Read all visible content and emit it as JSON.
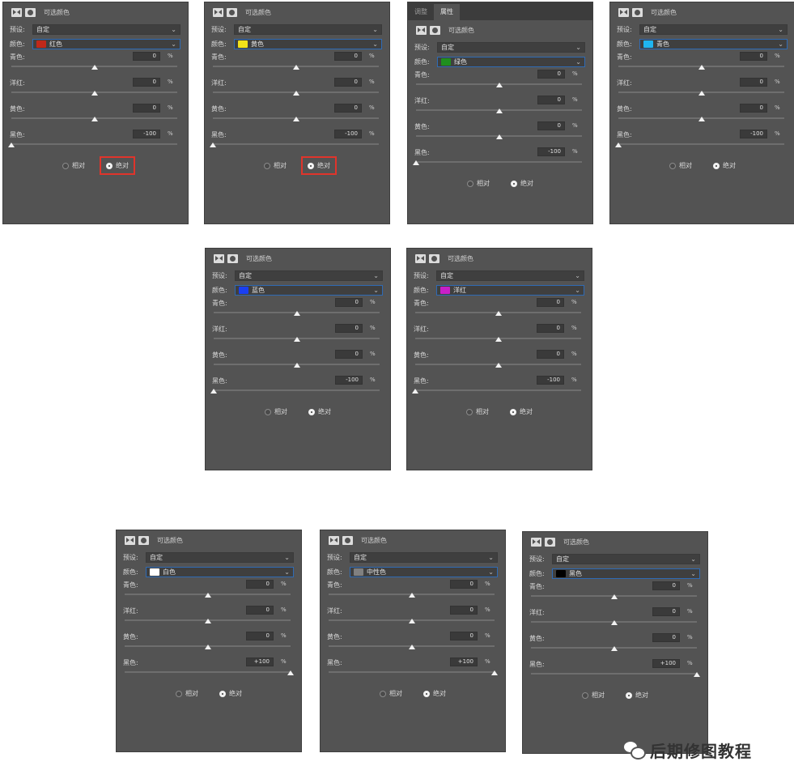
{
  "panel_labels": {
    "title": "可选颜色",
    "preset_label": "预设:",
    "preset_value": "自定",
    "color_label": "颜色:",
    "cyan": "青色:",
    "magenta": "洋红:",
    "yellow": "黄色:",
    "black": "黑色:",
    "relative": "相对",
    "absolute": "绝对",
    "percent": "%",
    "tab_adjust": "调整",
    "tab_properties": "属性"
  },
  "panels": [
    {
      "color_name": "红色",
      "swatch": "#c0281a",
      "values": [
        "0",
        "0",
        "0",
        "-100"
      ],
      "thumbs": [
        50,
        50,
        50,
        0
      ],
      "highlight": true,
      "tabs": false
    },
    {
      "color_name": "黄色",
      "swatch": "#f2e21a",
      "values": [
        "0",
        "0",
        "0",
        "-100"
      ],
      "thumbs": [
        50,
        50,
        50,
        0
      ],
      "highlight": true,
      "tabs": false
    },
    {
      "color_name": "绿色",
      "swatch": "#1f8f1f",
      "values": [
        "0",
        "0",
        "0",
        "-100"
      ],
      "thumbs": [
        50,
        50,
        50,
        0
      ],
      "highlight": false,
      "tabs": true
    },
    {
      "color_name": "青色",
      "swatch": "#1fb5f0",
      "values": [
        "0",
        "0",
        "0",
        "-100"
      ],
      "thumbs": [
        50,
        50,
        50,
        0
      ],
      "highlight": false,
      "tabs": false
    },
    {
      "color_name": "蓝色",
      "swatch": "#1a3ff2",
      "values": [
        "0",
        "0",
        "0",
        "-100"
      ],
      "thumbs": [
        50,
        50,
        50,
        0
      ],
      "highlight": false,
      "tabs": false
    },
    {
      "color_name": "洋红",
      "swatch": "#c81fc8",
      "values": [
        "0",
        "0",
        "0",
        "-100"
      ],
      "thumbs": [
        50,
        50,
        50,
        0
      ],
      "highlight": false,
      "tabs": false
    },
    {
      "color_name": "白色",
      "swatch": "#ffffff",
      "values": [
        "0",
        "0",
        "0",
        "+100"
      ],
      "thumbs": [
        50,
        50,
        50,
        100
      ],
      "highlight": false,
      "tabs": false
    },
    {
      "color_name": "中性色",
      "swatch": "#808080",
      "values": [
        "0",
        "0",
        "0",
        "+100"
      ],
      "thumbs": [
        50,
        50,
        50,
        100
      ],
      "highlight": false,
      "tabs": false
    },
    {
      "color_name": "黑色",
      "swatch": "#000000",
      "values": [
        "0",
        "0",
        "0",
        "+100"
      ],
      "thumbs": [
        50,
        50,
        50,
        100
      ],
      "highlight": false,
      "tabs": false
    }
  ],
  "watermark": {
    "text": "后期修图教程"
  }
}
